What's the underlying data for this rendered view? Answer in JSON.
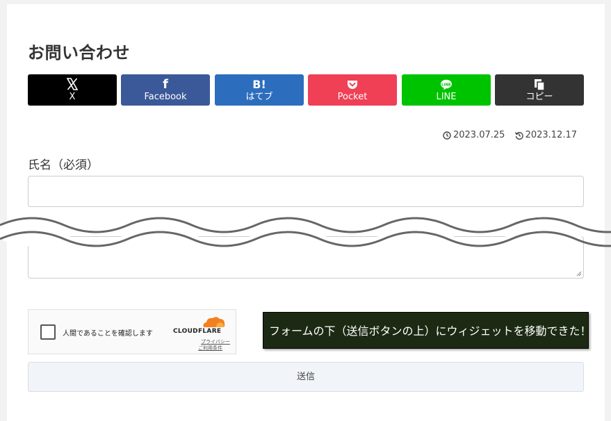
{
  "page": {
    "title": "お問い合わせ"
  },
  "share": {
    "buttons": [
      {
        "label": "X",
        "icon": "x-logo-icon",
        "color": "#000000"
      },
      {
        "label": "Facebook",
        "icon": "facebook-icon",
        "color": "#3b5998"
      },
      {
        "label": "はてブ",
        "icon": "hatena-bookmark-icon",
        "color": "#2c6ebd"
      },
      {
        "label": "Pocket",
        "icon": "pocket-icon",
        "color": "#ef4056"
      },
      {
        "label": "LINE",
        "icon": "line-icon",
        "color": "#00c300"
      },
      {
        "label": "コピー",
        "icon": "copy-icon",
        "color": "#333333"
      }
    ],
    "facebook_glyph": "f",
    "hatena_glyph": "B!"
  },
  "dates": {
    "published": "2023.07.25",
    "updated": "2023.12.17"
  },
  "form": {
    "name_label": "氏名（必須）",
    "name_value": "",
    "message_value": "",
    "submit_label": "送信"
  },
  "turnstile": {
    "label": "人間であることを確認します",
    "brand": "CLOUDFLARE",
    "privacy_link": "プライバシー",
    "terms_link": "ご利用条件",
    "brand_color": "#f38020"
  },
  "notice": {
    "text": "フォームの下（送信ボタンの上）にウィジェットを移動できた！"
  }
}
